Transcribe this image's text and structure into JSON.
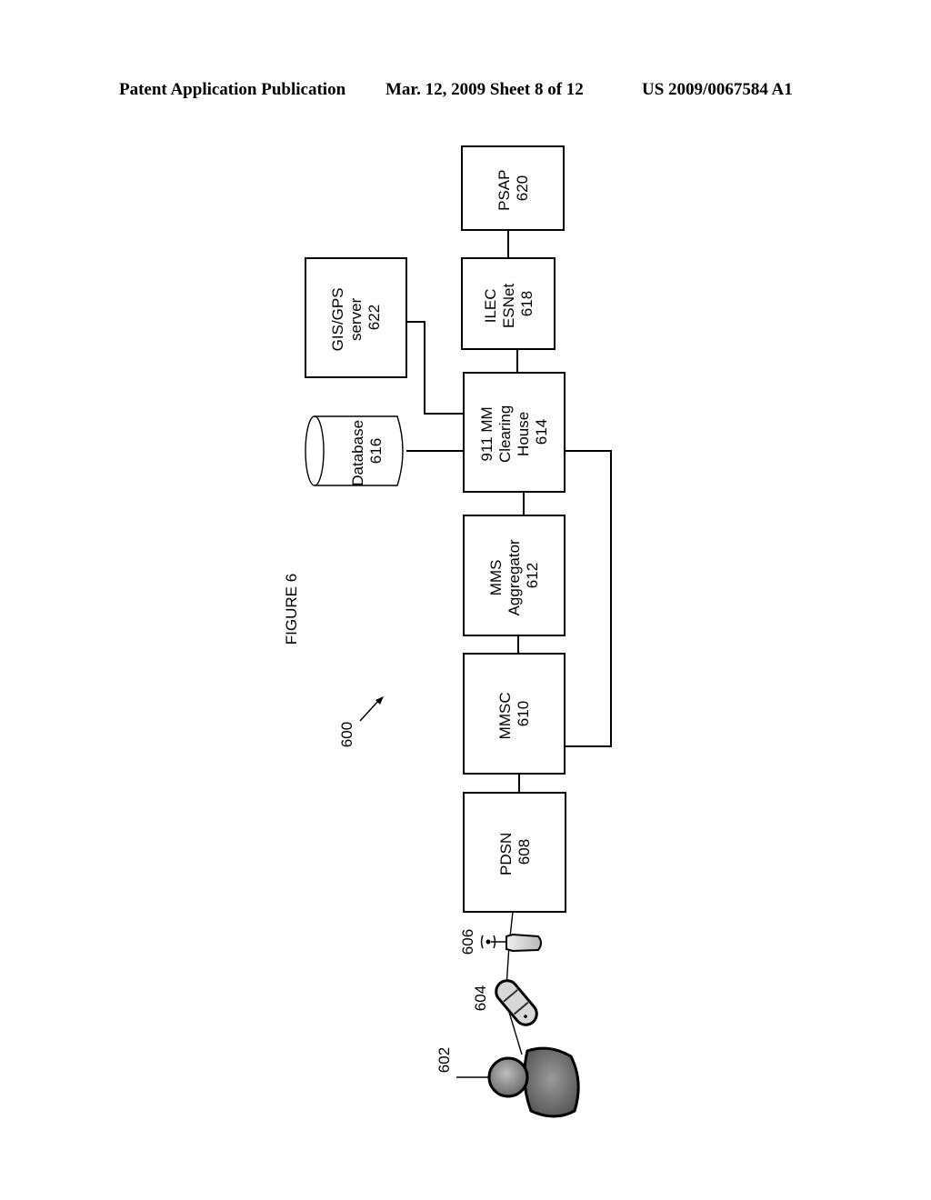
{
  "header": {
    "left": "Patent Application Publication",
    "middle": "Mar. 12, 2009  Sheet 8 of 12",
    "right": "US 2009/0067584 A1"
  },
  "figure": {
    "caption": "FIGURE 6",
    "reference": "600",
    "nodes": {
      "psap": {
        "line1": "PSAP",
        "line2": "620"
      },
      "ilec": {
        "line1": "ILEC",
        "line2": "ESNet",
        "line3": "618"
      },
      "gis": {
        "line1": "GIS/GPS",
        "line2": "server",
        "line3": "622"
      },
      "clearing": {
        "line1": "911 MM",
        "line2": "Clearing",
        "line3": "House",
        "line4": "614"
      },
      "database": {
        "line1": "Database",
        "line2": "616"
      },
      "aggregator": {
        "line1": "MMS",
        "line2": "Aggregator",
        "line3": "612"
      },
      "mmsc": {
        "line1": "MMSC",
        "line2": "610"
      },
      "pdsn": {
        "line1": "PDSN",
        "line2": "608"
      }
    },
    "labels": {
      "tower": "606",
      "phone": "604",
      "user": "602"
    }
  }
}
